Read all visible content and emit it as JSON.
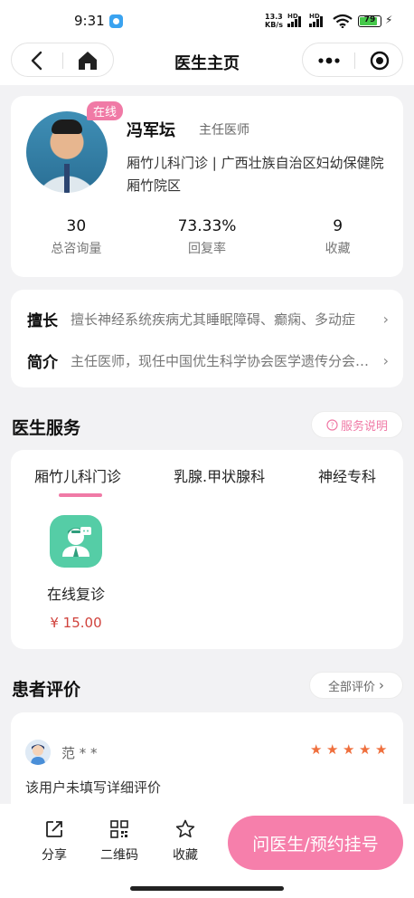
{
  "status_bar": {
    "time": "9:31",
    "net_speed_value": "13.3",
    "net_speed_unit": "KB/s",
    "signal_badge": "HD",
    "battery": "79"
  },
  "nav": {
    "title": "医生主页"
  },
  "doctor": {
    "online_badge": "在线",
    "name": "冯军坛",
    "title": "主任医师",
    "hospital": "厢竹儿科门诊 | 广西壮族自治区妇幼保健院厢竹院区",
    "stats": [
      {
        "value": "30",
        "label": "总咨询量"
      },
      {
        "value": "73.33%",
        "label": "回复率"
      },
      {
        "value": "9",
        "label": "收藏"
      }
    ]
  },
  "intro": {
    "specialty_label": "擅长",
    "specialty_text": "擅长神经系统疾病尤其睡眠障碍、癫痫、多动症",
    "bio_label": "简介",
    "bio_text": "主任医师，现任中国优生科学协会医学遗传分会委员"
  },
  "services": {
    "title": "医生服务",
    "help_label": "服务说明",
    "tabs": [
      "厢竹儿科门诊",
      "乳腺.甲状腺科",
      "神经专科"
    ],
    "active_tab": 0,
    "item": {
      "name": "在线复诊",
      "price": "¥ 15.00"
    }
  },
  "reviews": {
    "title": "患者评价",
    "all_label": "全部评价",
    "first": {
      "name": "范 * *",
      "stars": 5,
      "text": "该用户未填写详细评价"
    }
  },
  "bottom_bar": {
    "share": "分享",
    "qrcode": "二维码",
    "favorite": "收藏",
    "cta": "问医生/预约挂号"
  },
  "colors": {
    "accent_pink": "#f67fab",
    "service_green": "#55cda6",
    "price_red": "#d0423c",
    "star_orange": "#ef6f3d"
  }
}
